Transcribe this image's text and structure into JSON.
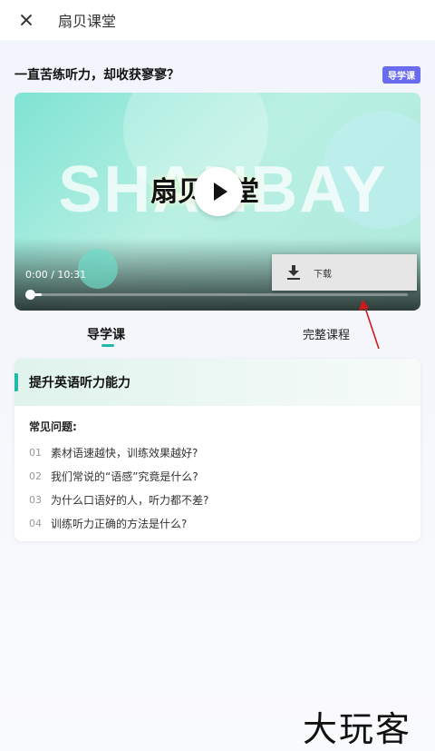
{
  "header": {
    "title": "扇贝课堂"
  },
  "headline": "一直苦练听力，却收获寥寥？",
  "badge": "导学课",
  "video": {
    "watermark": "SHANBAY",
    "brand": "扇贝课堂",
    "time": "0:00 / 10:31",
    "progress": 0.03,
    "menu": {
      "download_label": "下载"
    }
  },
  "tabs": [
    {
      "label": "导学课",
      "active": true
    },
    {
      "label": "完整课程",
      "active": false
    }
  ],
  "card": {
    "title": "提升英语听力能力",
    "faq_title": "常见问题:",
    "items": [
      {
        "num": "01",
        "text": "素材语速越快，训练效果越好?"
      },
      {
        "num": "02",
        "text": "我们常说的“语感”究竟是什么?"
      },
      {
        "num": "03",
        "text": "为什么口语好的人，听力都不差?"
      },
      {
        "num": "04",
        "text": "训练听力正确的方法是什么?"
      }
    ]
  },
  "site_watermark": "大玩客",
  "colors": {
    "accent": "#20b9a6",
    "badge": "#6a6cf0",
    "annotation_arrow": "#d11a1a"
  },
  "icons": [
    "close-icon",
    "play-icon",
    "download-icon"
  ]
}
